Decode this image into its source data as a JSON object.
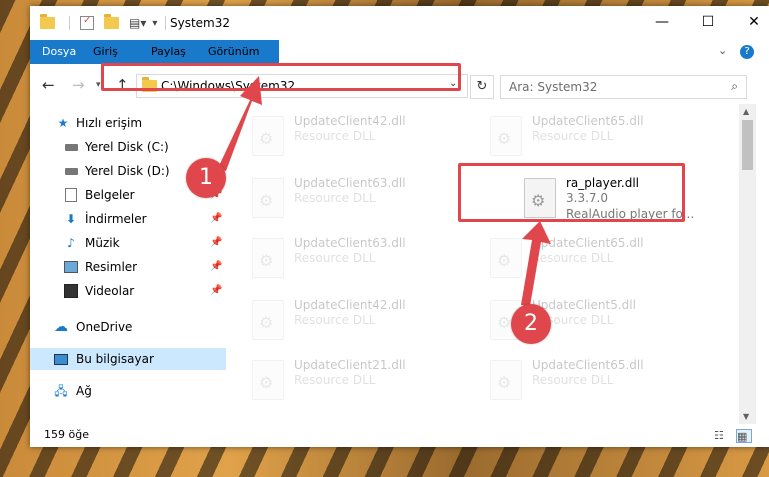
{
  "window": {
    "title": "System32",
    "controls": {
      "minimize": "—",
      "maximize": "☐",
      "close": "✕"
    }
  },
  "ribbon": {
    "tabs": [
      {
        "label": "Dosya",
        "active": true
      },
      {
        "label": "Giriş"
      },
      {
        "label": "Paylaş"
      },
      {
        "label": "Görünüm"
      }
    ],
    "expand_icon": "chevron-down-icon",
    "help_icon": "help-icon"
  },
  "address_bar": {
    "path": "C:\\Windows\\System32",
    "refresh_icon": "refresh-icon"
  },
  "search": {
    "placeholder": "Ara: System32"
  },
  "nav_pane": {
    "items": [
      {
        "label": "Hızlı erişim",
        "icon": "star-icon",
        "pinned": false
      },
      {
        "label": "Yerel Disk (C:)",
        "icon": "drive-icon",
        "pinned": false
      },
      {
        "label": "Yerel Disk (D:)",
        "icon": "drive-icon",
        "pinned": false
      },
      {
        "label": "Belgeler",
        "icon": "document-icon",
        "pinned": true
      },
      {
        "label": "İndirmeler",
        "icon": "download-icon",
        "pinned": true
      },
      {
        "label": "Müzik",
        "icon": "music-icon",
        "pinned": true
      },
      {
        "label": "Resimler",
        "icon": "picture-icon",
        "pinned": true
      },
      {
        "label": "Videolar",
        "icon": "video-icon",
        "pinned": true
      },
      {
        "label": "OneDrive",
        "icon": "cloud-icon",
        "pinned": false
      },
      {
        "label": "Bu bilgisayar",
        "icon": "computer-icon",
        "pinned": false,
        "selected": true
      },
      {
        "label": "Ağ",
        "icon": "network-icon",
        "pinned": false
      }
    ]
  },
  "files": [
    {
      "name": "UpdateClient42.dll",
      "desc": "Resource DLL",
      "faded": true
    },
    {
      "name": "UpdateClient65.dll",
      "desc": "Resource DLL",
      "faded": true
    },
    {
      "name": "UpdateClient63.dll",
      "desc": "Resource DLL",
      "faded": true
    },
    {
      "name": "ra_player.dll",
      "desc": "3.3.7.0",
      "desc2": "RealAudio player fo...",
      "faded": false
    },
    {
      "name": "UpdateClient63.dll",
      "desc": "Resource DLL",
      "faded": true
    },
    {
      "name": "UpdateClient65.dll",
      "desc": "Resource DLL",
      "faded": true
    },
    {
      "name": "UpdateClient42.dll",
      "desc": "Resource DLL",
      "faded": true
    },
    {
      "name": "UpdateClient5.dll",
      "desc": "Resource DLL",
      "faded": true
    },
    {
      "name": "UpdateClient21.dll",
      "desc": "Resource DLL",
      "faded": true
    },
    {
      "name": "UpdateClient65.dll",
      "desc": "Resource DLL",
      "faded": true
    }
  ],
  "status": {
    "count": "159 öğe"
  },
  "annotations": {
    "step1": "1",
    "step2": "2",
    "color": "#e0474c"
  },
  "colors": {
    "accent": "#1979ca",
    "selection": "#cce8ff"
  }
}
